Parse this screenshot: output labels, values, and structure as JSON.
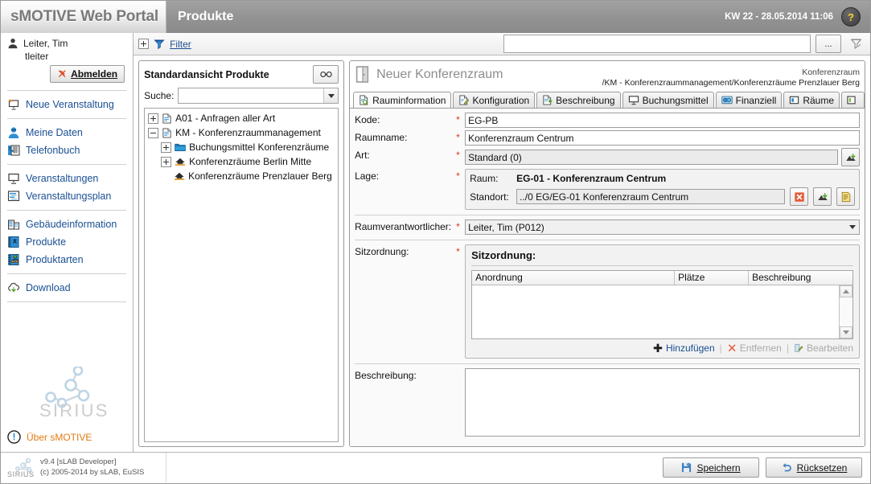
{
  "header": {
    "brand": "sMOTIVE Web Portal",
    "page_title": "Produkte",
    "datetime": "KW 22 - 28.05.2014 11:06",
    "help_glyph": "?"
  },
  "sidebar": {
    "user_name": "Leiter, Tim",
    "user_login": "tleiter",
    "logout_label": "Abmelden",
    "groups": [
      {
        "items": [
          {
            "label": "Neue Veranstaltung",
            "icon": "new-presentation-icon"
          }
        ]
      },
      {
        "items": [
          {
            "label": "Meine Daten",
            "icon": "user-icon"
          },
          {
            "label": "Telefonbuch",
            "icon": "phonebook-icon"
          }
        ]
      },
      {
        "items": [
          {
            "label": "Veranstaltungen",
            "icon": "presentation-icon"
          },
          {
            "label": "Veranstaltungsplan",
            "icon": "schedule-icon"
          }
        ]
      },
      {
        "items": [
          {
            "label": "Gebäudeinformation",
            "icon": "building-icon"
          },
          {
            "label": "Produkte",
            "icon": "products-icon"
          },
          {
            "label": "Produktarten",
            "icon": "product-types-icon"
          }
        ]
      },
      {
        "items": [
          {
            "label": "Download",
            "icon": "download-cloud-icon"
          }
        ]
      }
    ],
    "logo_text": "SIRIUS",
    "about_label": "Über sMOTIVE"
  },
  "filterbar": {
    "expand_glyph": "+",
    "filter_label": "Filter",
    "filter_value": "",
    "ellipsis_label": "...",
    "clear_filter_icon": "filter-clear-icon"
  },
  "tree_panel": {
    "title": "Standardansicht Produkte",
    "binoculars_icon": "binoculars-icon",
    "search_label": "Suche:",
    "search_value": "",
    "search_placeholder": "",
    "nodes": [
      {
        "label": "A01 - Anfragen aller Art",
        "level": 1,
        "toggle": "+",
        "icon": "document-icon"
      },
      {
        "label": "KM - Konferenzraummanagement",
        "level": 1,
        "toggle": "-",
        "icon": "document-icon"
      },
      {
        "label": "Buchungsmittel Konferenzräume",
        "level": 2,
        "toggle": "+",
        "icon": "folder-icon"
      },
      {
        "label": "Konferenzräume Berlin Mitte",
        "level": 2,
        "toggle": "+",
        "icon": "room-icon"
      },
      {
        "label": "Konferenzräume Prenzlauer Berg",
        "level": 3,
        "toggle": "",
        "icon": "room-icon"
      }
    ]
  },
  "form": {
    "title": "Neuer Konferenzraum",
    "title_icon": "door-icon",
    "breadcrumb_line1": "Konferenzraum",
    "breadcrumb_line2": "/KM - Konferenzraummanagement/Konferenzräume Prenzlauer Berg",
    "tabs": [
      {
        "label": "Rauminformation",
        "icon": "room-info-icon",
        "active": true
      },
      {
        "label": "Konfiguration",
        "icon": "config-icon",
        "active": false
      },
      {
        "label": "Beschreibung",
        "icon": "description-icon",
        "active": false
      },
      {
        "label": "Buchungsmittel",
        "icon": "booking-icon",
        "active": false
      },
      {
        "label": "Finanziell",
        "icon": "finance-icon",
        "active": false
      },
      {
        "label": "Räume",
        "icon": "rooms-icon",
        "active": false
      },
      {
        "label": "",
        "icon": "more-tab-icon",
        "active": false
      }
    ],
    "fields": {
      "kode_label": "Kode:",
      "kode_value": "EG-PB",
      "raumname_label": "Raumname:",
      "raumname_value": "Konferenzraum Centrum",
      "art_label": "Art:",
      "art_value": "Standard (0)",
      "lage_label": "Lage:",
      "lage_raum_label": "Raum:",
      "lage_raum_value": "EG-01 - Konferenzraum Centrum",
      "lage_standort_label": "Standort:",
      "lage_standort_value": "../0 EG/EG-01 Konferenzraum Centrum",
      "verantwortlicher_label": "Raumverantwortlicher:",
      "verantwortlicher_value": "Leiter, Tim (P012)",
      "sitzordnung_label": "Sitzordnung:",
      "beschreibung_label": "Beschreibung:",
      "beschreibung_value": ""
    },
    "sitzordnung": {
      "title": "Sitzordnung:",
      "columns": [
        "Anordnung",
        "Plätze",
        "Beschreibung"
      ],
      "rows": [],
      "actions": [
        {
          "label": "Hinzufügen",
          "icon": "plus-icon",
          "enabled": true
        },
        {
          "label": "Entfernen",
          "icon": "remove-x-icon",
          "enabled": false
        },
        {
          "label": "Bearbeiten",
          "icon": "edit-icon",
          "enabled": false
        }
      ]
    }
  },
  "footer": {
    "version": "v9.4 [sLAB Developer]",
    "copyright": "(c) 2005-2014 by sLAB, EuSIS",
    "save_label": "Speichern",
    "reset_label": "Rücksetzen"
  }
}
